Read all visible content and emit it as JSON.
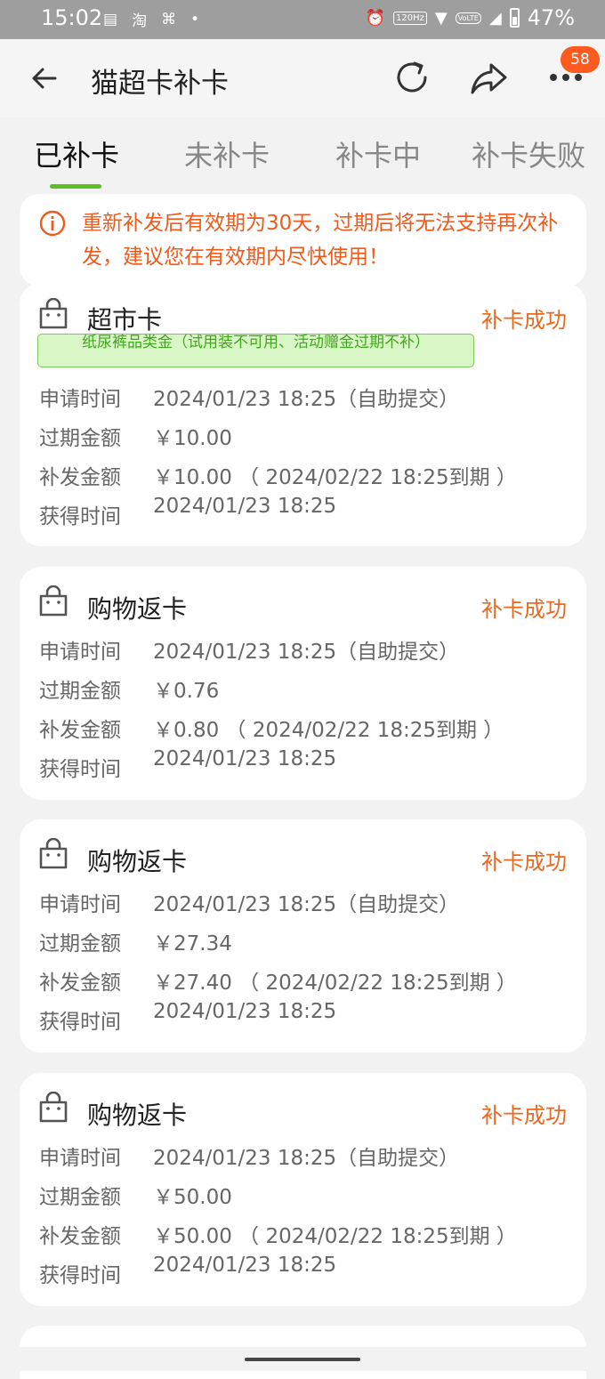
{
  "status_bar": {
    "time": "15:02",
    "left_icons": [
      "notes-icon",
      "taobao-icon",
      "app-icon",
      "dot-icon"
    ],
    "network_label": "120Hz",
    "volte_label": "VoLTE",
    "battery": "47%"
  },
  "header": {
    "title": "猫超卡补卡",
    "badge": "58"
  },
  "tabs": [
    {
      "label": "已补卡",
      "active": true
    },
    {
      "label": "未补卡",
      "active": false
    },
    {
      "label": "补卡中",
      "active": false
    },
    {
      "label": "补卡失败",
      "active": false
    }
  ],
  "notice": {
    "text": "重新补发后有效期为30天，过期后将无法支持再次补发，建议您在有效期内尽快使用！"
  },
  "cards": [
    {
      "name": "超市卡",
      "status": "补卡成功",
      "tag": "纸尿裤品类金（试用装不可用、活动赠金过期不补）",
      "rows": [
        {
          "label": "申请时间",
          "value": "2024/01/23 18:25（自助提交）"
        },
        {
          "label": "过期金额",
          "value": "￥10.00"
        },
        {
          "label": "补发金额",
          "value": "￥10.00 （ 2024/02/22 18:25到期 ）"
        },
        {
          "label": "获得时间",
          "value": "2024/01/23 18:25"
        }
      ]
    },
    {
      "name": "购物返卡",
      "status": "补卡成功",
      "rows": [
        {
          "label": "申请时间",
          "value": "2024/01/23 18:25（自助提交）"
        },
        {
          "label": "过期金额",
          "value": "￥0.76"
        },
        {
          "label": "补发金额",
          "value": "￥0.80 （ 2024/02/22 18:25到期 ）"
        },
        {
          "label": "获得时间",
          "value": "2024/01/23 18:25"
        }
      ]
    },
    {
      "name": "购物返卡",
      "status": "补卡成功",
      "rows": [
        {
          "label": "申请时间",
          "value": "2024/01/23 18:25（自助提交）"
        },
        {
          "label": "过期金额",
          "value": "￥27.34"
        },
        {
          "label": "补发金额",
          "value": "￥27.40 （ 2024/02/22 18:25到期 ）"
        },
        {
          "label": "获得时间",
          "value": "2024/01/23 18:25"
        }
      ]
    },
    {
      "name": "购物返卡",
      "status": "补卡成功",
      "rows": [
        {
          "label": "申请时间",
          "value": "2024/01/23 18:25（自助提交）"
        },
        {
          "label": "过期金额",
          "value": "￥50.00"
        },
        {
          "label": "补发金额",
          "value": "￥50.00 （ 2024/02/22 18:25到期 ）"
        },
        {
          "label": "获得时间",
          "value": "2024/01/23 18:25"
        }
      ]
    }
  ],
  "colors": {
    "accent_green": "#5ac025",
    "status_orange": "#e8691f",
    "notice_orange": "#f05a1a",
    "badge_red": "#ff5a1f"
  }
}
